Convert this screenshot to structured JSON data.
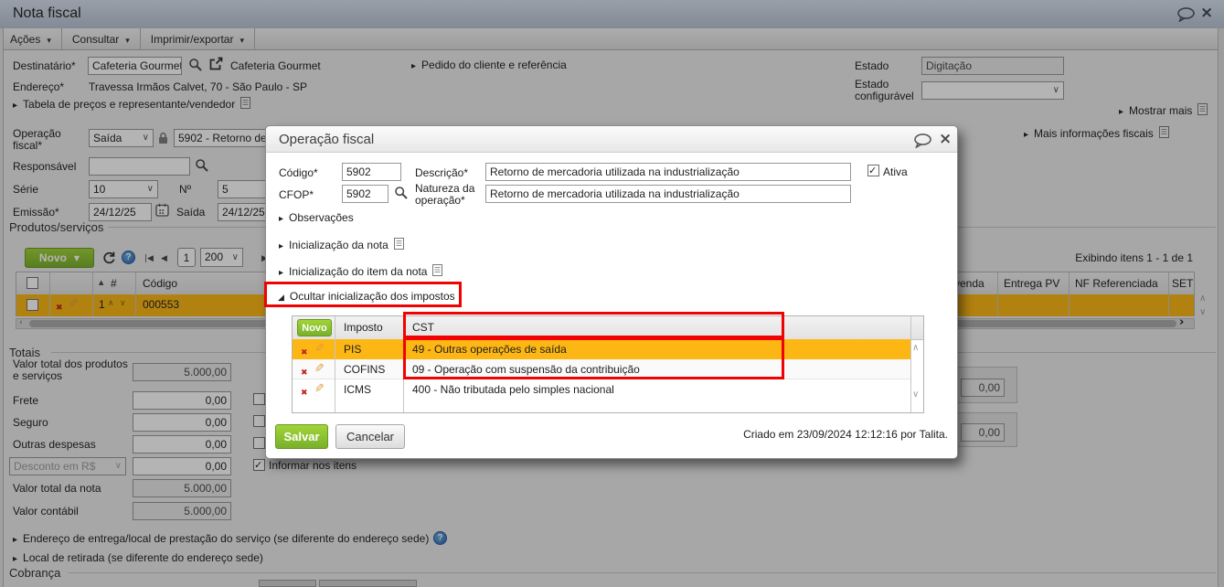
{
  "window": {
    "title": "Nota fiscal"
  },
  "menu": {
    "acoes": "Ações",
    "consultar": "Consultar",
    "imprimir": "Imprimir/exportar"
  },
  "form": {
    "destinatario_label": "Destinatário*",
    "destinatario_value": "Cafeteria Gourmet",
    "destinatario_name": "Cafeteria Gourmet",
    "pedido_toggle": "Pedido do cliente e referência",
    "endereco_label": "Endereço*",
    "endereco_value": "Travessa Irmãos Calvet, 70 - São Paulo - SP",
    "tabela_toggle": "Tabela de preços e representante/vendedor",
    "estado_label": "Estado",
    "estado_value": "Digitação",
    "estado_config_label": "Estado configurável",
    "mostrar_mais": "Mostrar mais",
    "mais_info": "Mais informações fiscais",
    "operacao_label": "Operação fiscal*",
    "operacao_tipo": "Saída",
    "operacao_value": "5902 - Retorno de",
    "responsavel_label": "Responsável",
    "serie_label": "Série",
    "serie_value": "10",
    "numero_label": "Nº",
    "numero_value": "5",
    "emissao_label": "Emissão*",
    "emissao_value": "24/12/25",
    "saida_label": "Saída",
    "saida_value": "24/12/25"
  },
  "produtos": {
    "legend": "Produtos/serviços",
    "novo_button": "Novo",
    "page": "1",
    "page_size": "200",
    "exibindo": "Exibindo itens 1 - 1 de 1",
    "col_num": "#",
    "col_codigo": "Código",
    "col_venda": "venda",
    "col_entrega": "Entrega PV",
    "col_nf": "NF Referenciada",
    "col_set": "SET",
    "row": {
      "num": "1",
      "codigo": "000553"
    }
  },
  "totais": {
    "legend": "Totais",
    "l1": "Valor total dos produtos e serviços",
    "v1": "5.000,00",
    "l2": "Frete",
    "v2": "0,00",
    "l3": "Seguro",
    "v3": "0,00",
    "l4": "Outras despesas",
    "v4": "0,00",
    "l5": "Desconto em R$",
    "v5": "0,00",
    "l6": "Valor total da nota",
    "v6": "5.000,00",
    "l7": "Valor contábil",
    "v7": "5.000,00",
    "informar": "Informar nos itens",
    "side1": "0,00",
    "side2": "0,00"
  },
  "footer": {
    "entrega": "Endereço de entrega/local de prestação do serviço (se diferente do endereço sede)",
    "retirada": "Local de retirada (se diferente do endereço sede)",
    "cobranca": "Cobrança"
  },
  "modal": {
    "title": "Operação fiscal",
    "codigo_label": "Código*",
    "codigo_value": "5902",
    "descricao_label": "Descrição*",
    "descricao_value": "Retorno de mercadoria utilizada na industrialização",
    "cfop_label": "CFOP*",
    "cfop_value": "5902",
    "natureza_label": "Natureza da operação*",
    "natureza_value": "Retorno de mercadoria utilizada na industrialização",
    "ativa": "Ativa",
    "sec_observacoes": "Observações",
    "sec_init_nota": "Inicialização da nota",
    "sec_init_item": "Inicialização do item da nota",
    "sec_impostos": "Ocultar inicialização dos impostos",
    "grid": {
      "novo": "Novo",
      "col_imposto": "Imposto",
      "col_cst": "CST",
      "rows": [
        {
          "imposto": "PIS",
          "cst": "49 - Outras operações de saída"
        },
        {
          "imposto": "COFINS",
          "cst": "09 - Operação com suspensão da contribuição"
        },
        {
          "imposto": "ICMS",
          "cst": "400 - Não tributada pelo simples nacional"
        }
      ]
    },
    "salvar": "Salvar",
    "cancelar": "Cancelar",
    "created": "Criado em 23/09/2024 12:12:16 por Talita."
  },
  "colors": {
    "accent_green": "#7CB32E",
    "row_highlight": "#FDB714",
    "annotation_red": "#F00202",
    "titlebar_blue": "#C7D3E2"
  }
}
